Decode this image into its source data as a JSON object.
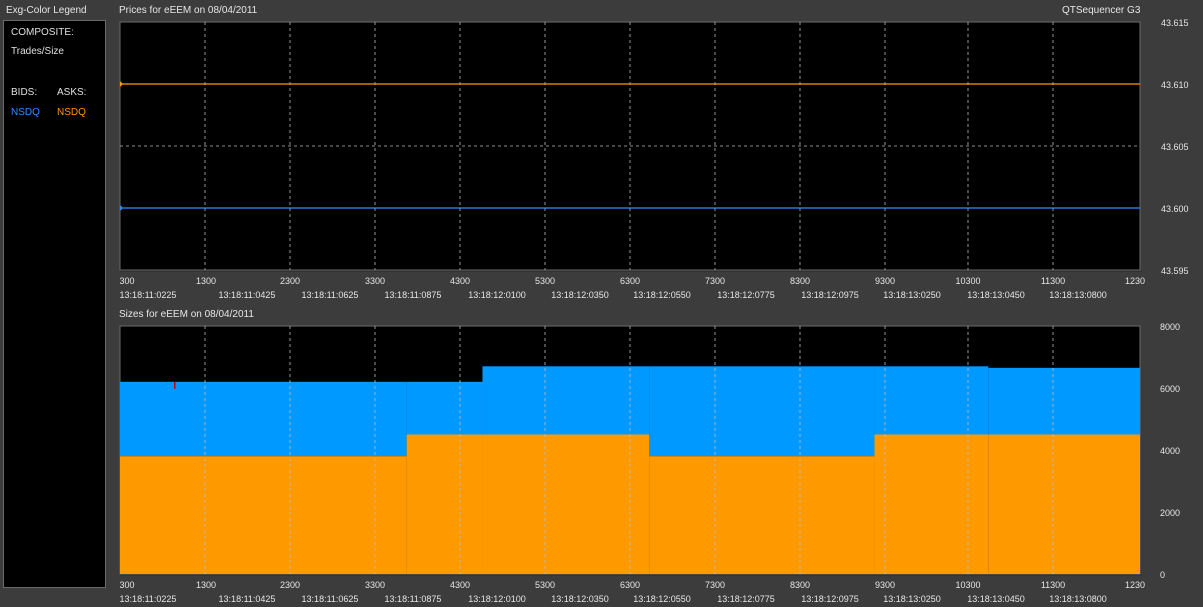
{
  "legend": {
    "title": "Exg-Color Legend",
    "composite_label": "COMPOSITE:",
    "trades_size_label": "Trades/Size",
    "bids_label": "BIDS:",
    "asks_label": "ASKS:",
    "bid_exchange": "NSDQ",
    "ask_exchange": "NSDQ"
  },
  "app_title": "QTSequencer G3",
  "colors": {
    "bid": "#2f8fff",
    "ask": "#ff9900",
    "bid_fill": "#0099ff",
    "ask_fill": "#ff9900",
    "trade_marker": "#cc0000",
    "plot_bg": "#000000",
    "grid": "#bbbbbb"
  },
  "chart_data": [
    {
      "type": "line",
      "title": "Prices for  eEEM  on  08/04/2011",
      "x_ticks": [
        "300",
        "1300",
        "2300",
        "3300",
        "4300",
        "5300",
        "6300",
        "7300",
        "8300",
        "9300",
        "10300",
        "11300",
        "1230"
      ],
      "time_labels": [
        "13:18:11:0225",
        "13:18:11:0425",
        "13:18:11:0625",
        "13:18:11:0875",
        "13:18:12:0100",
        "13:18:12:0350",
        "13:18:12:0550",
        "13:18:12:0775",
        "13:18:12:0975",
        "13:18:13:0250",
        "13:18:13:0450",
        "13:18:13:0800"
      ],
      "ylim": [
        43.595,
        43.615
      ],
      "y_ticks": [
        "43.615",
        "43.610",
        "43.605",
        "43.600",
        "43.595"
      ],
      "series": [
        {
          "role": "ask",
          "values": [
            43.61,
            43.61
          ]
        },
        {
          "role": "bid",
          "values": [
            43.6,
            43.6
          ]
        }
      ]
    },
    {
      "type": "area",
      "title": "Sizes for  eEEM  on  08/04/2011",
      "x_ticks": [
        "300",
        "1300",
        "2300",
        "3300",
        "4300",
        "5300",
        "6300",
        "7300",
        "8300",
        "9300",
        "10300",
        "11300",
        "1230"
      ],
      "time_labels": [
        "13:18:11:0225",
        "13:18:11:0425",
        "13:18:11:0625",
        "13:18:11:0875",
        "13:18:12:0100",
        "13:18:12:0350",
        "13:18:12:0550",
        "13:18:12:0775",
        "13:18:12:0975",
        "13:18:13:0250",
        "13:18:13:0450",
        "13:18:13:0800"
      ],
      "ylim": [
        0,
        8000
      ],
      "y_ticks": [
        "8000",
        "6000",
        "4000",
        "2000",
        "0"
      ],
      "stacked_segments": [
        {
          "x0": 0,
          "x1": 3400,
          "ask": 3800,
          "total": 6200
        },
        {
          "x0": 3400,
          "x1": 4300,
          "ask": 4500,
          "total": 6200
        },
        {
          "x0": 4300,
          "x1": 6280,
          "ask": 4500,
          "total": 6700
        },
        {
          "x0": 6280,
          "x1": 8950,
          "ask": 3800,
          "total": 6700
        },
        {
          "x0": 8950,
          "x1": 10300,
          "ask": 4500,
          "total": 6700
        },
        {
          "x0": 10300,
          "x1": 12100,
          "ask": 4500,
          "total": 6650
        }
      ],
      "trades": [
        {
          "x": 650,
          "size": 6100
        }
      ]
    }
  ]
}
